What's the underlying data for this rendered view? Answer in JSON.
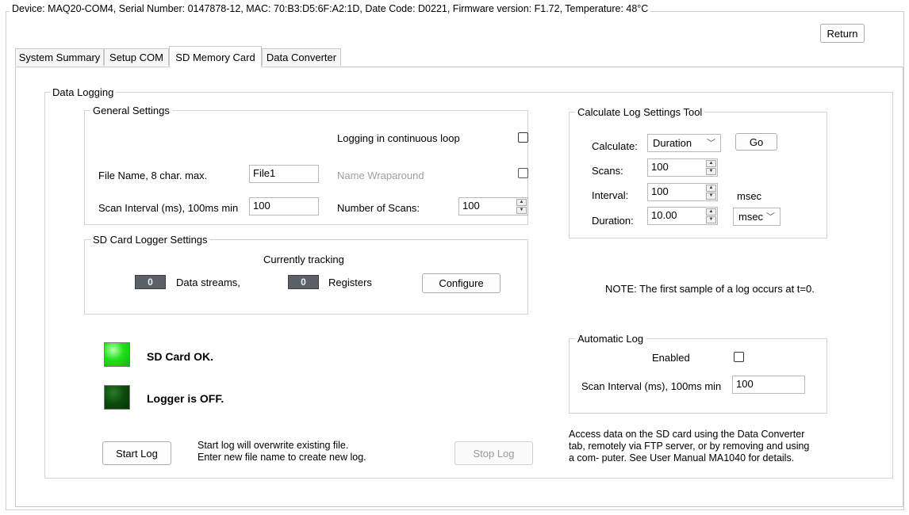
{
  "device_info": "Device: MAQ20-COM4, Serial Number: 0147878-12,   MAC: 70:B3:D5:6F:A2:1D,   Date Code: D0221,   Firmware version: F1.72,   Temperature: 48°C",
  "return_label": "Return",
  "tabs": [
    "System Summary",
    "Setup COM",
    "SD Memory Card",
    "Data Converter"
  ],
  "data_logging": {
    "title": "Data Logging",
    "general": {
      "title": "General Settings",
      "continuous_loop_label": "Logging in continuous loop",
      "file_name_label": "File Name, 8 char. max.",
      "file_name_value": "File1",
      "name_wraparound_label": "Name Wraparound",
      "scan_interval_label": "Scan Interval (ms), 100ms min",
      "scan_interval_value": "100",
      "num_scans_label": "Number of Scans:",
      "num_scans_value": "100"
    },
    "sd_logger": {
      "title": "SD Card Logger Settings",
      "tracking_label": "Currently tracking",
      "data_streams_count": "0",
      "data_streams_label": "Data streams,",
      "registers_count": "0",
      "registers_label": "Registers",
      "configure_label": "Configure"
    },
    "status": {
      "sd_card": "SD Card OK.",
      "logger": "Logger is OFF.",
      "sd_led_color": "#22e01c",
      "logger_led_color": "#0b4a0b"
    },
    "start_log_label": "Start Log",
    "start_log_note_1": "Start log will overwrite existing file.",
    "start_log_note_2": "Enter new file name to create new log.",
    "stop_log_label": "Stop Log",
    "calc": {
      "title": "Calculate Log Settings Tool",
      "calculate_label": "Calculate:",
      "calculate_value": "Duration",
      "go_label": "Go",
      "scans_label": "Scans:",
      "scans_value": "100",
      "interval_label": "Interval:",
      "interval_value": "100",
      "interval_unit": "msec",
      "duration_label": "Duration:",
      "duration_value": "10.00",
      "duration_unit": "msec"
    },
    "note": "NOTE: The first sample of a log occurs at t=0.",
    "auto_log": {
      "title": "Automatic Log",
      "enabled_label": "Enabled",
      "scan_interval_label": "Scan Interval (ms), 100ms min",
      "scan_interval_value": "100"
    },
    "access_note_1": "Access data on the SD card using the Data Converter",
    "access_note_2": "tab, remotely via FTP server, or by removing and using",
    "access_note_3": "a com- puter. See User Manual MA1040 for details."
  }
}
